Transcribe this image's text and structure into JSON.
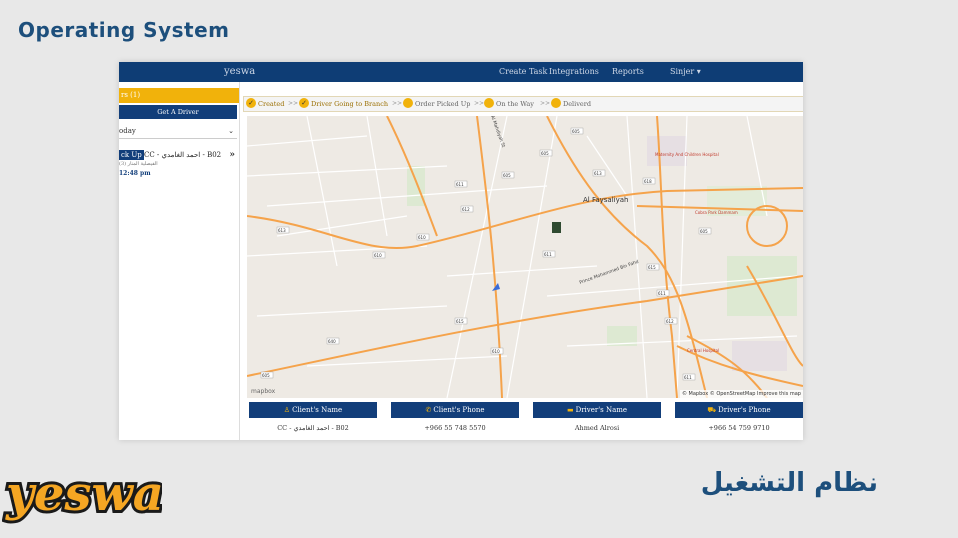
{
  "slide": {
    "title": "Operating System",
    "arabic_title": "نظام التشغيل",
    "logo_text": "yeswa"
  },
  "app": {
    "brand": "yeswa",
    "nav": [
      "Create Task",
      "Integrations",
      "Reports",
      "Sinjer ▾"
    ],
    "colors": {
      "primary": "#123e7a",
      "accent": "#f1b20b"
    }
  },
  "sidebar": {
    "header": "rs (1)",
    "get_driver": "Get A Driver",
    "filter_value": "oday",
    "card": {
      "tag": "ck Up",
      "name": "CC - احمد الغامدي - B02",
      "sub": "الفيصلية المنار (3)",
      "time": "12:48 pm",
      "arrow_icon": "»"
    }
  },
  "status_steps": [
    {
      "label": "Created",
      "done": true
    },
    {
      "label": "Driver Going to Branch",
      "done": true
    },
    {
      "label": "Order Picked Up",
      "done": false
    },
    {
      "label": "On the Way",
      "done": false
    },
    {
      "label": "Deliverd",
      "done": false
    }
  ],
  "map": {
    "district_label": "Al Faysaliyah",
    "places": [
      "Maternity And Children Hospital",
      "Cobra Park Dammam",
      "Central Hospital"
    ],
    "roads": [
      "Prince Mohammed Bin Fahd",
      "Al Mahdiyah St"
    ],
    "route_numbers": [
      "605",
      "605",
      "605",
      "613",
      "611",
      "612",
      "613",
      "610",
      "610",
      "611",
      "615",
      "611",
      "615",
      "612",
      "610",
      "640",
      "611",
      "618",
      "605",
      "605"
    ],
    "attribution": "© Mapbox © OpenStreetMap Improve this map",
    "logo": "mapbox"
  },
  "table": {
    "headers": [
      {
        "icon": "user-icon",
        "label": "Client's Name"
      },
      {
        "icon": "phone-icon",
        "label": "Client's Phone"
      },
      {
        "icon": "id-card-icon",
        "label": "Driver's Name"
      },
      {
        "icon": "car-icon",
        "label": "Driver's Phone"
      }
    ],
    "row": [
      "CC - احمد الغامدي - B02",
      "+966 55 748 5570",
      "Ahmed Alrosi",
      "+966 54 759 9710"
    ]
  }
}
